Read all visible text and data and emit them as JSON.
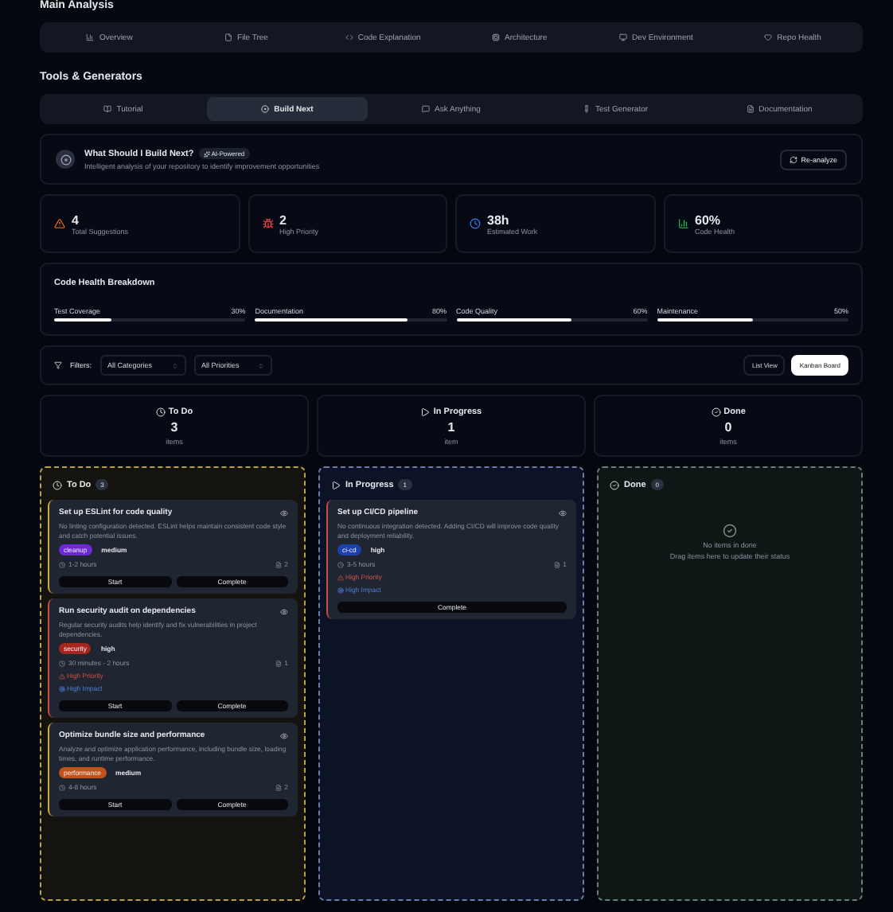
{
  "sections": [
    {
      "title": "Main Analysis",
      "tabs": [
        {
          "label": "Overview",
          "selected": false
        },
        {
          "label": "File Tree",
          "selected": false
        },
        {
          "label": "Code Explanation",
          "selected": false
        },
        {
          "label": "Architecture",
          "selected": false
        },
        {
          "label": "Dev Environment",
          "selected": false
        },
        {
          "label": "Repo Health",
          "selected": false
        }
      ]
    },
    {
      "title": "Tools & Generators",
      "tabs": [
        {
          "label": "Tutorial",
          "selected": false
        },
        {
          "label": "Build Next",
          "selected": true
        },
        {
          "label": "Ask Anything",
          "selected": false
        },
        {
          "label": "Test Generator",
          "selected": false
        },
        {
          "label": "Documentation",
          "selected": false
        }
      ]
    }
  ],
  "build_next": {
    "title": "What Should I Build Next?",
    "badge": "AI-Powered",
    "subtitle": "Intelligent analysis of your repository to identify improvement opportunities",
    "button": "Re-analyze"
  },
  "stats": [
    {
      "kind": "warning",
      "value": "4",
      "label": "Total Suggestions"
    },
    {
      "kind": "priority",
      "value": "2",
      "label": "High Priority"
    },
    {
      "kind": "time",
      "value": "38h",
      "label": "Estimated Work"
    },
    {
      "kind": "health",
      "value": "60%",
      "label": "Code Health"
    }
  ],
  "health": {
    "title": "Code Health Breakdown",
    "metrics": [
      {
        "label": "Test Coverage",
        "reading": "30%",
        "level": 0.3
      },
      {
        "label": "Documentation",
        "reading": "80%",
        "level": 0.8
      },
      {
        "label": "Code Quality",
        "reading": "60%",
        "level": 0.6
      },
      {
        "label": "Maintenance",
        "reading": "50%",
        "level": 0.5
      }
    ]
  },
  "filters": {
    "label": "Filters:",
    "selects": [
      "All Categories",
      "All Priorities"
    ],
    "views": [
      {
        "label": "List View",
        "selected": false
      },
      {
        "label": "Kanban Board",
        "selected": true
      }
    ]
  },
  "summaries": [
    {
      "kind": "todo",
      "title": "To Do",
      "count": "3",
      "unit": "items"
    },
    {
      "kind": "progress",
      "title": "In Progress",
      "count": "1",
      "unit": "item"
    },
    {
      "kind": "done",
      "title": "Done",
      "count": "0",
      "unit": "items"
    }
  ],
  "columns": [
    {
      "kind": "todo",
      "title": "To Do",
      "count": "3",
      "cards": [
        {
          "title": "Set up ESLint for code quality",
          "color": "#d4a83a",
          "description": "No linting configuration detected. ESLint helps maintain consistent code style and catch potential issues.",
          "tag": {
            "label": "cleanup",
            "color": "#6d28d9"
          },
          "priority": "medium",
          "time": "1-2 hours",
          "count": "2",
          "actions": [
            "Start",
            "Complete"
          ]
        },
        {
          "title": "Run security audit on dependencies",
          "color": "#c94a4a",
          "description": "Regular security audits help identify and fix vulnerabilities in project dependencies.",
          "tag": {
            "label": "security",
            "color": "#a3271f"
          },
          "priority": "high",
          "time": "30 minutes - 2 hours",
          "count": "1",
          "flags": [
            {
              "kind": "priority",
              "label": "High Priority"
            },
            {
              "kind": "impact",
              "label": "High Impact"
            }
          ],
          "actions": [
            "Start",
            "Complete"
          ]
        },
        {
          "title": "Optimize bundle size and performance",
          "color": "#d4a83a",
          "description": "Analyze and optimize application performance, including bundle size, loading times, and runtime performance.",
          "tag": {
            "label": "performance",
            "color": "#c2531a"
          },
          "priority": "medium",
          "time": "4-8 hours",
          "count": "2",
          "actions": [
            "Start",
            "Complete"
          ]
        }
      ]
    },
    {
      "kind": "progress",
      "title": "In Progress",
      "count": "1",
      "cards": [
        {
          "title": "Set up CI/CD pipeline",
          "color": "#c94a4a",
          "description": "No continuous integration detected. Adding CI/CD will improve code quality and deployment reliability.",
          "tag": {
            "label": "ci-cd",
            "color": "#1e40af"
          },
          "priority": "high",
          "time": "3-5 hours",
          "count": "1",
          "flags": [
            {
              "kind": "priority",
              "label": "High Priority"
            },
            {
              "kind": "impact",
              "label": "High Impact"
            }
          ],
          "actions": [
            "Complete"
          ]
        }
      ]
    },
    {
      "kind": "done",
      "title": "Done",
      "count": "0",
      "empty_title": "No items in done",
      "empty_text": "Drag items here to update their status"
    }
  ]
}
